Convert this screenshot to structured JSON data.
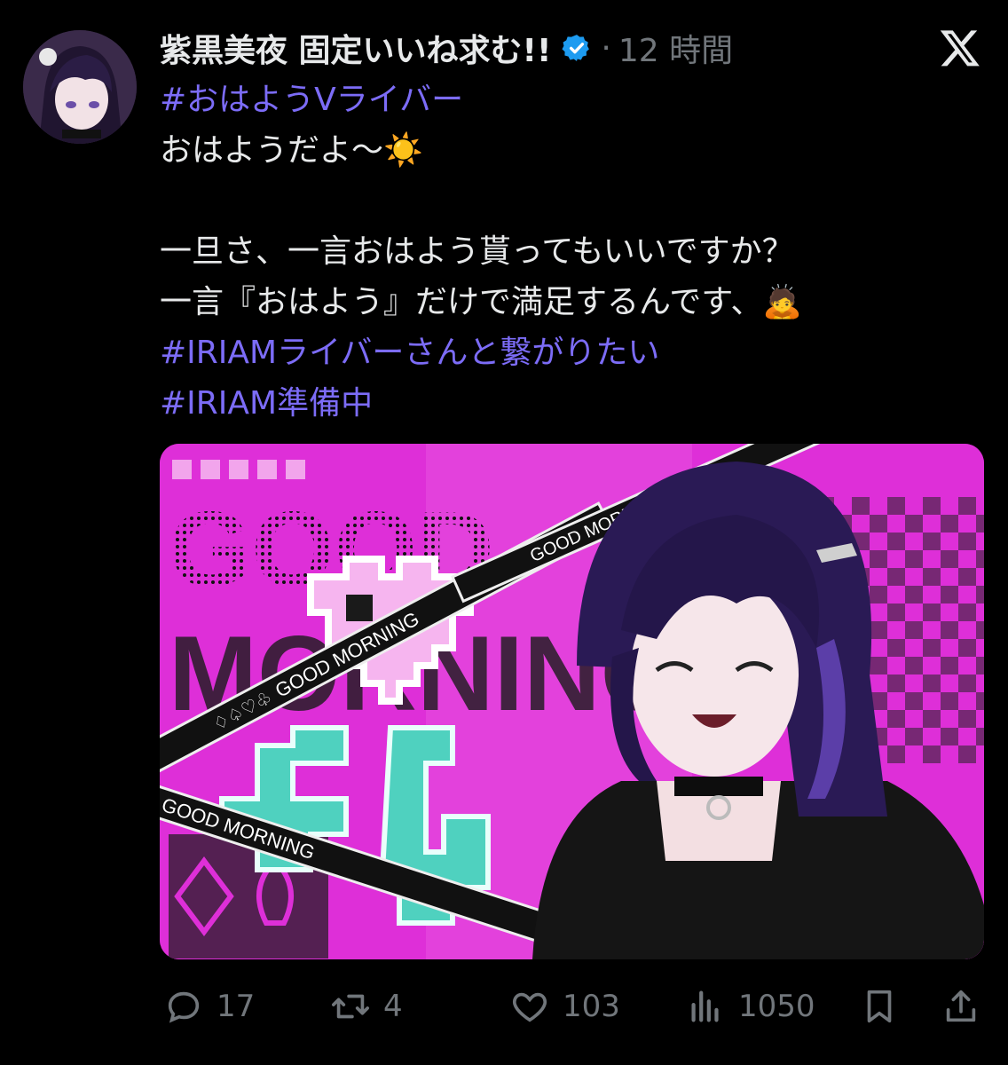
{
  "post": {
    "author": "紫黒美夜 固定いいね求む!!",
    "separator": "·",
    "time": "12 時間",
    "lines": {
      "l1": "#おはようVライバー",
      "l2": "おはようだよ〜☀️",
      "l3": "一旦さ、一言おはよう貰ってもいいですか？",
      "l4": "一言『おはよう』だけで満足するんです、🙇",
      "l5": "#IRIAMライバーさんと繋がりたい",
      "l6": " #IRIAM準備中"
    }
  },
  "media": {
    "banner_text": "GOOD MORNING",
    "big_text_1": "GOOD",
    "big_text_2": "MORNING",
    "suits": "♢♤♡♧"
  },
  "actions": {
    "replies": "17",
    "reposts": "4",
    "likes": "103",
    "views": "1050"
  },
  "icons": [
    "avatar",
    "verified-badge-icon",
    "x-logo-icon",
    "reply-icon",
    "repost-icon",
    "like-icon",
    "views-icon",
    "bookmark-icon",
    "share-icon"
  ],
  "colors": {
    "background": "#000000",
    "hashtag": "#7c6cf7",
    "muted": "#71767b",
    "verified": "#1d9bf0",
    "magenta": "#de2fd8",
    "teal": "#4fd1bf"
  }
}
